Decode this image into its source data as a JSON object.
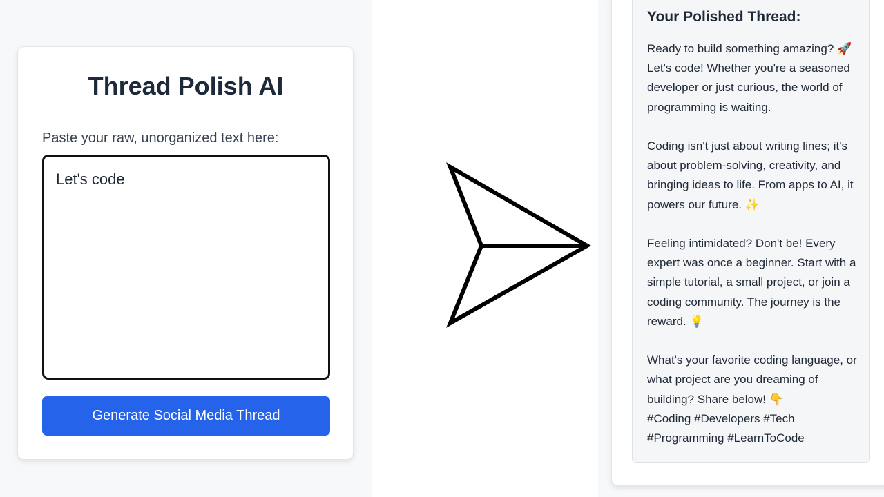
{
  "app": {
    "title": "Thread Polish AI"
  },
  "input_form": {
    "label": "Paste your raw, unorganized text here:",
    "value": "Let's code",
    "submit_label": "Generate Social Media Thread"
  },
  "output": {
    "title": "Your Polished Thread:",
    "paragraphs": [
      "Ready to build something amazing? 🚀 Let's code! Whether you're a seasoned developer or just curious, the world of programming is waiting.",
      "Coding isn't just about writing lines; it's about problem-solving, creativity, and bringing ideas to life. From apps to AI, it powers our future. ✨",
      "Feeling intimidated? Don't be! Every expert was once a beginner. Start with a simple tutorial, a small project, or join a coding community. The journey is the reward. 💡",
      "What's your favorite coding language, or what project are you dreaming of building? Share below! 👇",
      "#Coding #Developers #Tech #Programming #LearnToCode"
    ]
  },
  "icons": {
    "arrow": "send-arrow-icon"
  },
  "colors": {
    "primary_button": "#2563eb",
    "title_text": "#1e2a3b",
    "page_background": "#f7f8fa"
  }
}
